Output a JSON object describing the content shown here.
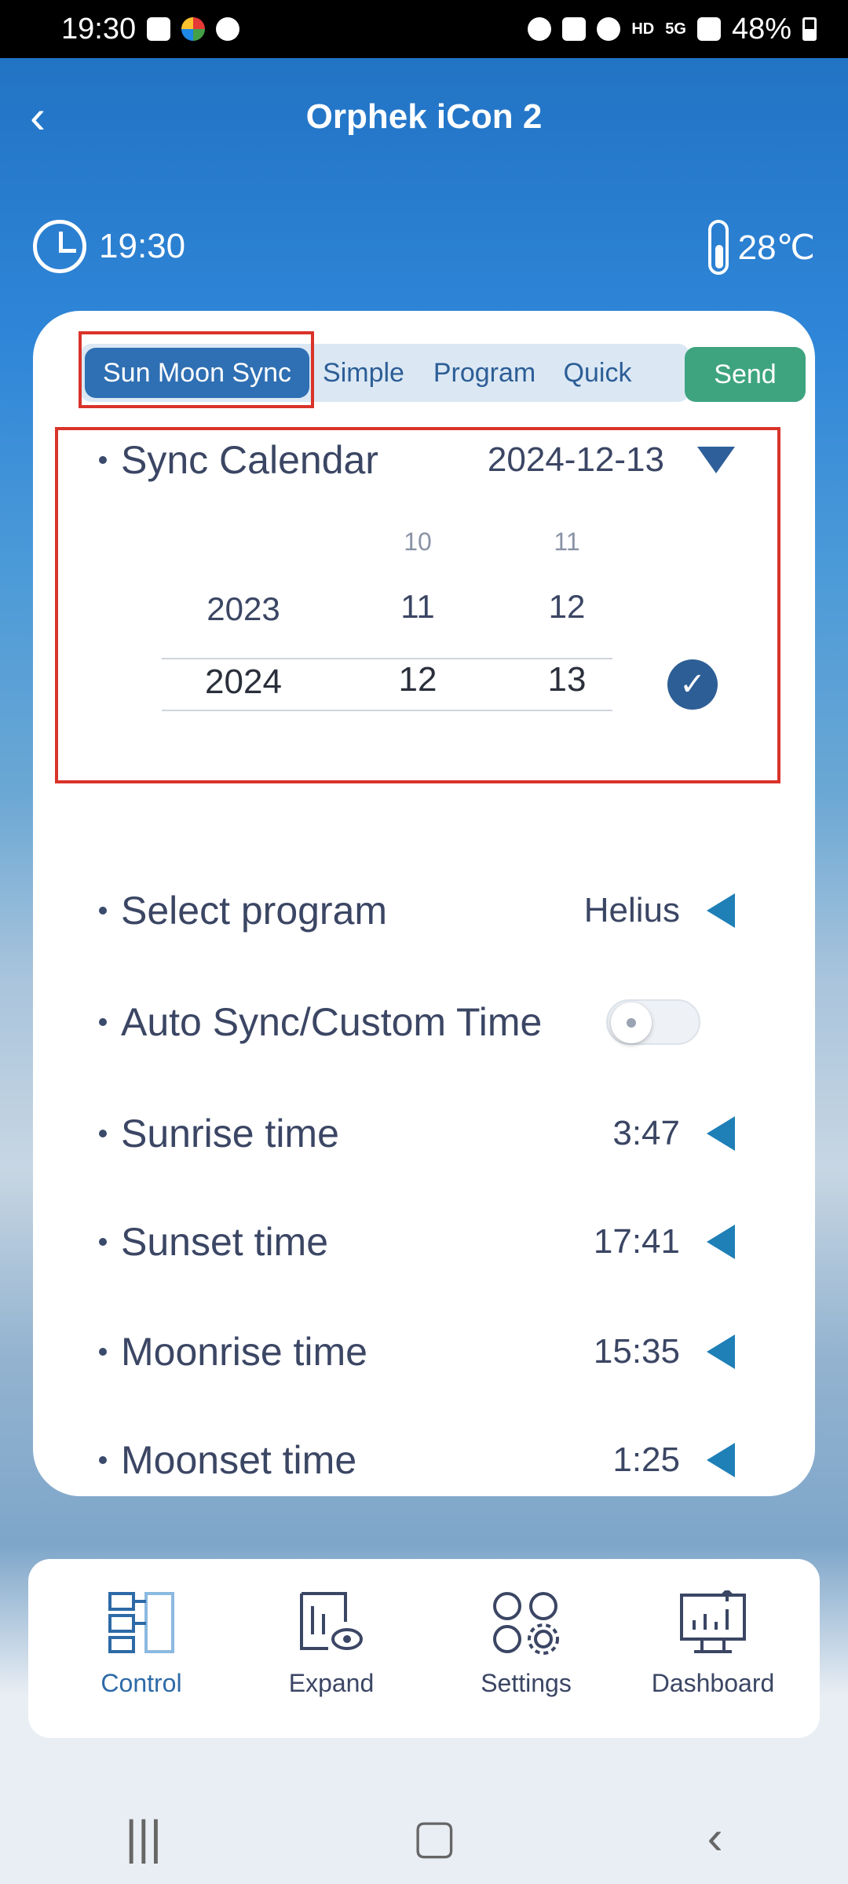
{
  "status_bar": {
    "time": "19:30",
    "network_label": "HD",
    "signal_label": "5G",
    "battery": "48%"
  },
  "header": {
    "title": "Orphek iCon 2"
  },
  "info": {
    "time": "19:30",
    "temperature": "28℃"
  },
  "tabs": {
    "items": [
      "Sun Moon Sync",
      "Simple",
      "Program",
      "Quick"
    ],
    "send_label": "Send"
  },
  "calendar": {
    "label": "Sync Calendar",
    "value": "2024-12-13",
    "picker": {
      "year_above": "2023",
      "year_selected": "2024",
      "month_above2": "10",
      "month_above": "11",
      "month_selected": "12",
      "day_above2": "11",
      "day_above": "12",
      "day_selected": "13"
    }
  },
  "settings": [
    {
      "label": "Select program",
      "value": "Helius"
    },
    {
      "label": "Auto Sync/Custom Time",
      "value": ""
    },
    {
      "label": "Sunrise time",
      "value": "3:47"
    },
    {
      "label": "Sunset time",
      "value": "17:41"
    },
    {
      "label": "Moonrise time",
      "value": "15:35"
    },
    {
      "label": "Moonset time",
      "value": "1:25"
    }
  ],
  "bottom_nav": [
    {
      "label": "Control",
      "icon": "control-icon"
    },
    {
      "label": "Expand",
      "icon": "expand-icon"
    },
    {
      "label": "Settings",
      "icon": "settings-icon"
    },
    {
      "label": "Dashboard",
      "icon": "dashboard-icon"
    }
  ],
  "colors": {
    "accent": "#2f6fb3",
    "send": "#3ea480",
    "highlight": "#d9332a",
    "arrow": "#1f7fb7"
  }
}
